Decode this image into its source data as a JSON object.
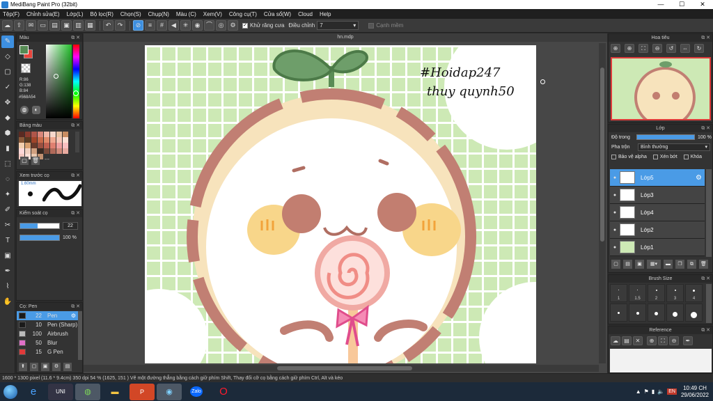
{
  "window": {
    "title": "MediBang Paint Pro (32bit)",
    "minimize": "—",
    "maximize": "☐",
    "close": "✕"
  },
  "menu": [
    "Tệp(F)",
    "Chỉnh sửa(E)",
    "Lớp(L)",
    "Bộ lọc(R)",
    "Chọn(S)",
    "Chụp(N)",
    "Màu (C)",
    "Xem(V)",
    "Công cụ(T)",
    "Cửa sổ(W)",
    "Cloud",
    "Help"
  ],
  "toolbar": {
    "antialias_label": "Khử răng cưa",
    "adjust_label": "Điều chỉnh",
    "adjust_value": "7",
    "edge_label": "Cạnh mềm"
  },
  "panels": {
    "color": {
      "title": "Màu",
      "r": "R:86",
      "g": "G:138",
      "b": "B:84",
      "hex": "#568A54",
      "fg": "#568A54",
      "bg": "#e8453c"
    },
    "palette": {
      "title": "Bảng màu",
      "dash": "---"
    },
    "preview": {
      "title": "Xem trước cọ",
      "size": "1.60mm"
    },
    "brush_control": {
      "title": "Kiểm soát cọ",
      "size": "22",
      "opacity": "100 %"
    },
    "brush": {
      "title": "Cọ: Pen",
      "items": [
        {
          "size": "22",
          "name": "Pen",
          "color": "#1a1a1a",
          "selected": true
        },
        {
          "size": "10",
          "name": "Pen (Sharp)",
          "color": "#1a1a1a",
          "selected": false
        },
        {
          "size": "100",
          "name": "Airbrush",
          "color": "#bbbbbb",
          "selected": false
        },
        {
          "size": "50",
          "name": "Blur",
          "color": "#e070c8",
          "selected": false
        },
        {
          "size": "15",
          "name": "G Pen",
          "color": "#e03a3a",
          "selected": false
        }
      ]
    },
    "navigator": {
      "title": "Hoa tiêu"
    },
    "layer": {
      "title": "Lớp",
      "opacity_label": "Độ trong",
      "opacity_value": "100 %",
      "blend_label": "Pha trộn",
      "blend_value": "Bình thường",
      "protect_alpha": "Bảo vệ alpha",
      "clipping": "Xén bớt",
      "lock": "Khóa",
      "items": [
        {
          "name": "Lớp5",
          "selected": true
        },
        {
          "name": "Lớp3",
          "selected": false
        },
        {
          "name": "Lớp4",
          "selected": false
        },
        {
          "name": "Lớp2",
          "selected": false
        },
        {
          "name": "Lớp1",
          "selected": false
        }
      ]
    },
    "brush_size": {
      "title": "Brush Size",
      "labels": [
        "1",
        "1.5",
        "2",
        "3",
        "4"
      ]
    },
    "reference": {
      "title": "Reference"
    }
  },
  "document": {
    "tab": "hn.mdp",
    "signature": "#Hoidap247 thuy quynh50"
  },
  "status": {
    "text": "1600 * 1300 pixel   (11.6 * 9.4cm)  350 dpi   54 %   (1625, 151 )   Vẽ một đường thẳng bằng cách giữ phím Shift, Thay đổi cỡ cọ bằng cách giữ phím Ctrl, Alt và kéo"
  },
  "taskbar": {
    "time": "10:49 CH",
    "date": "29/06/2022",
    "zalo": "Zalo",
    "lang": "EN"
  }
}
